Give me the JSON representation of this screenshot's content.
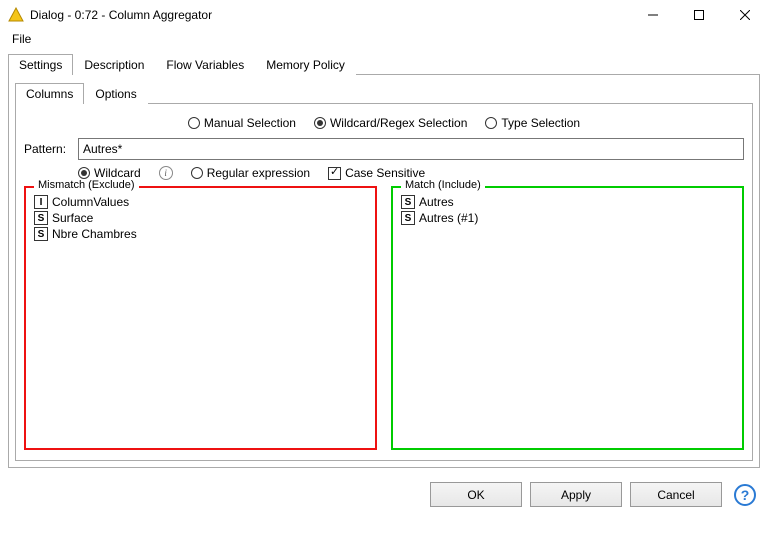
{
  "window": {
    "title": "Dialog - 0:72 - Column Aggregator"
  },
  "menubar": {
    "file": "File"
  },
  "outerTabs": {
    "settings": "Settings",
    "description": "Description",
    "flowVariables": "Flow Variables",
    "memoryPolicy": "Memory Policy"
  },
  "innerTabs": {
    "columns": "Columns",
    "options": "Options"
  },
  "selectionMode": {
    "manual": "Manual Selection",
    "wildcard": "Wildcard/Regex Selection",
    "type": "Type Selection"
  },
  "pattern": {
    "label": "Pattern:",
    "value": "Autres*"
  },
  "patternOptions": {
    "wildcard": "Wildcard",
    "regex": "Regular expression",
    "caseSensitive": "Case Sensitive"
  },
  "mismatch": {
    "legend": "Mismatch (Exclude)",
    "items": [
      {
        "type": "I",
        "label": "ColumnValues"
      },
      {
        "type": "S",
        "label": "Surface"
      },
      {
        "type": "S",
        "label": "Nbre Chambres"
      }
    ]
  },
  "match": {
    "legend": "Match (Include)",
    "items": [
      {
        "type": "S",
        "label": "Autres"
      },
      {
        "type": "S",
        "label": "Autres (#1)"
      }
    ]
  },
  "buttons": {
    "ok": "OK",
    "apply": "Apply",
    "cancel": "Cancel"
  }
}
